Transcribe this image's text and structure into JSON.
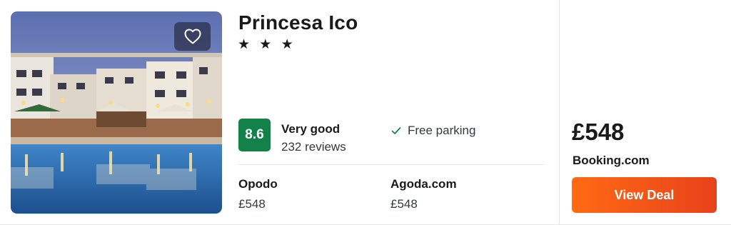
{
  "hotel": {
    "name": "Princesa Ico",
    "stars": "★ ★ ★",
    "image_icon": "hotel-photo",
    "favorite_icon": "heart-outline-icon"
  },
  "rating": {
    "score": "8.6",
    "label": "Very good",
    "reviews": "232 reviews",
    "badge_color": "#12814a"
  },
  "amenities": [
    {
      "icon": "check-icon",
      "label": "Free parking"
    }
  ],
  "providers": [
    {
      "name": "Opodo",
      "price": "£548"
    },
    {
      "name": "Agoda.com",
      "price": "£548"
    }
  ],
  "deal": {
    "price": "£548",
    "site": "Booking.com",
    "button_label": "View Deal",
    "button_color": "#f4581a"
  }
}
